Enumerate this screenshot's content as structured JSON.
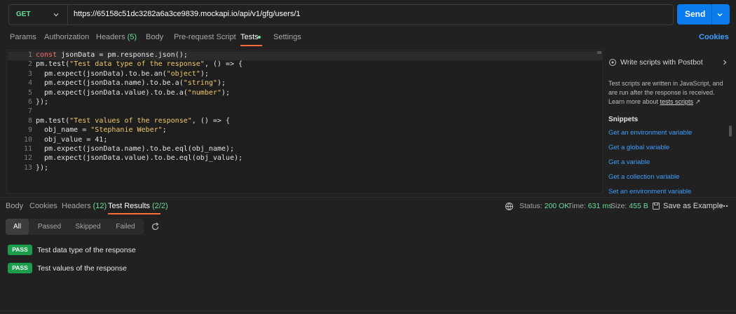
{
  "request": {
    "method": "GET",
    "url": "https://65158c51dc3282a6a3ce9839.mockapi.io/api/v1/gfg/users/1",
    "send_label": "Send"
  },
  "request_tabs": {
    "params": "Params",
    "authorization": "Authorization",
    "headers": "Headers",
    "headers_count": "(5)",
    "body": "Body",
    "prerequest": "Pre-request Script",
    "tests": "Tests",
    "settings": "Settings",
    "cookies": "Cookies"
  },
  "editor": {
    "line_numbers": [
      "1",
      "2",
      "3",
      "4",
      "5",
      "6",
      "7",
      "8",
      "9",
      "10",
      "11",
      "12",
      "13"
    ],
    "lines": [
      {
        "kw": "const",
        "code": " jsonData = pm.response.json();"
      },
      {
        "pre": "pm.test(",
        "str": "\"Test data type of the response\"",
        "post": ", () => {"
      },
      {
        "pre": "  pm.expect(jsonData).to.be.an(",
        "str": "\"object\"",
        "post": ");"
      },
      {
        "pre": "  pm.expect(jsonData.name).to.be.a(",
        "str": "\"string\"",
        "post": ");"
      },
      {
        "pre": "  pm.expect(jsonData.value).to.be.a(",
        "str": "\"number\"",
        "post": ");"
      },
      {
        "pre": "});"
      },
      {
        "pre": ""
      },
      {
        "pre": "pm.test(",
        "str": "\"Test values of the response\"",
        "post": ", () => {"
      },
      {
        "pre": "  obj_name = ",
        "str": "\"Stephanie Weber\"",
        "post": ";"
      },
      {
        "pre": "  obj_value = 41;"
      },
      {
        "pre": "  pm.expect(jsonData.name).to.be.eql(obj_name);"
      },
      {
        "pre": "  pm.expect(jsonData.value).to.be.eql(obj_value);"
      },
      {
        "pre": "});"
      }
    ]
  },
  "side_panel": {
    "postbot_label": "Write scripts with Postbot",
    "desc_line1": "Test scripts are written in JavaScript, and",
    "desc_line2": "are run after the response is received.",
    "desc_line3_prefix": "Learn more about ",
    "desc_link": "tests scripts",
    "desc_arrow": "↗",
    "snippets_title": "Snippets",
    "snippets": [
      "Get an environment variable",
      "Get a global variable",
      "Get a variable",
      "Get a collection variable",
      "Set an environment variable"
    ]
  },
  "response_tabs": {
    "body": "Body",
    "cookies": "Cookies",
    "headers": "Headers",
    "headers_count": "(12)",
    "test_results": "Test Results",
    "test_results_count": "(2/2)"
  },
  "status": {
    "status_label": "Status:",
    "status_value": "200 OK",
    "time_label": "Time:",
    "time_value": "631 ms",
    "size_label": "Size:",
    "size_value": "455 B",
    "save_example": "Save as Example"
  },
  "filters": [
    "All",
    "Passed",
    "Skipped",
    "Failed"
  ],
  "results": [
    {
      "badge": "PASS",
      "name": "Test data type of the response"
    },
    {
      "badge": "PASS",
      "name": "Test values of the response"
    }
  ],
  "colors": {
    "accent": "#097bed",
    "pass": "#1a9e4c",
    "tab_underline": "#ff6c37",
    "method": "#6bdd9a",
    "link": "#3e9eff"
  }
}
